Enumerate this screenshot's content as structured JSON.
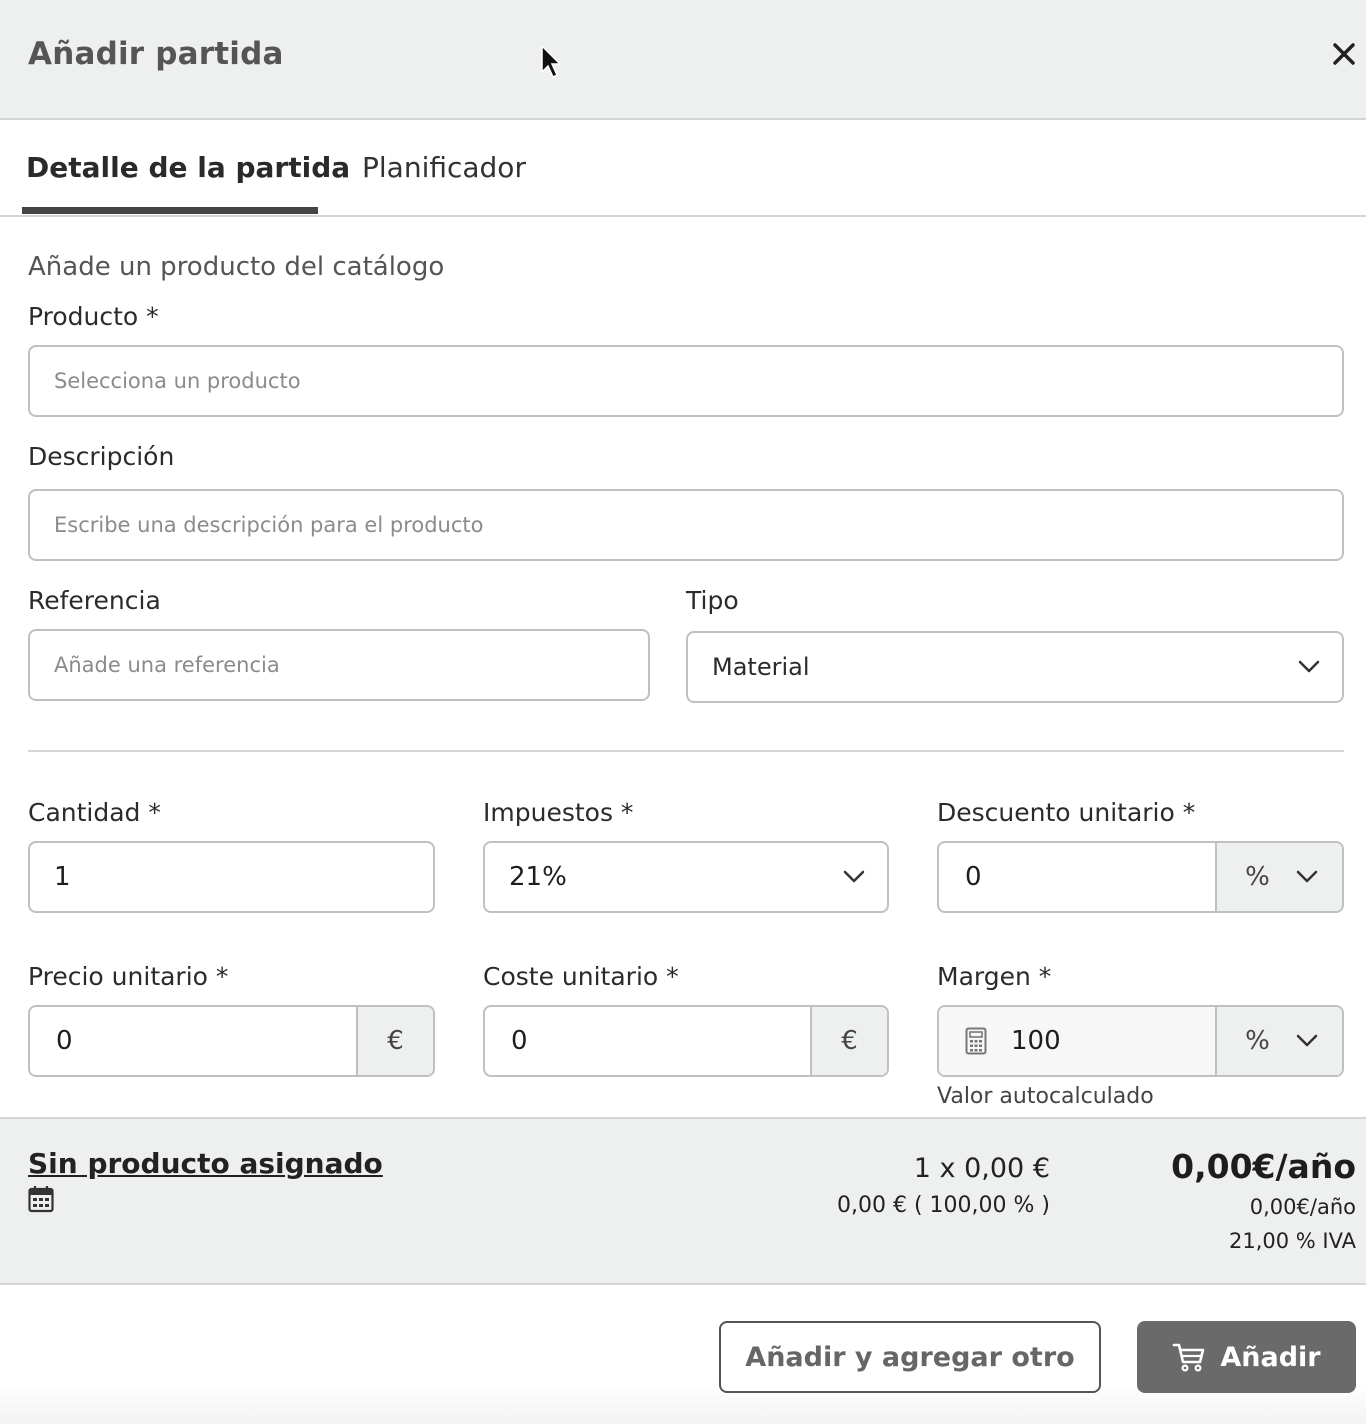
{
  "header": {
    "title": "Añadir partida",
    "close_icon": "close-icon"
  },
  "tabs": [
    {
      "label": "Detalle de la partida",
      "active": true
    },
    {
      "label": "Planificador",
      "active": false
    }
  ],
  "form": {
    "section_title": "Añade un producto del catálogo",
    "producto": {
      "label": "Producto *",
      "placeholder": "Selecciona un producto"
    },
    "descripcion": {
      "label": "Descripción",
      "placeholder": "Escribe una descripción para el producto"
    },
    "referencia": {
      "label": "Referencia",
      "placeholder": "Añade una referencia"
    },
    "tipo": {
      "label": "Tipo",
      "value": "Material"
    },
    "cantidad": {
      "label": "Cantidad *",
      "value": "1"
    },
    "impuestos": {
      "label": "Impuestos *",
      "value": "21%"
    },
    "descuento": {
      "label": "Descuento unitario *",
      "value": "0",
      "unit": "%"
    },
    "precio": {
      "label": "Precio unitario *",
      "value": "0",
      "unit": "€"
    },
    "coste": {
      "label": "Coste unitario *",
      "value": "0",
      "unit": "€"
    },
    "margen": {
      "label": "Margen *",
      "value": "100",
      "unit": "%",
      "helper": "Valor autocalculado"
    }
  },
  "summary": {
    "product": "Sin producto asignado",
    "quantity_line": "1 x 0,00 €",
    "cost_line": "0,00 € ( 100,00 % )",
    "total": "0,00€/año",
    "total_sub": "0,00€/año",
    "iva": "21,00 % IVA"
  },
  "footer": {
    "secondary_button": "Añadir y agregar otro",
    "primary_button": "Añadir"
  },
  "colors": {
    "header_bg": "#eef0ef",
    "primary_button": "#6a6a6a",
    "tab_underline": "#454545",
    "border": "#bfc1c0"
  }
}
